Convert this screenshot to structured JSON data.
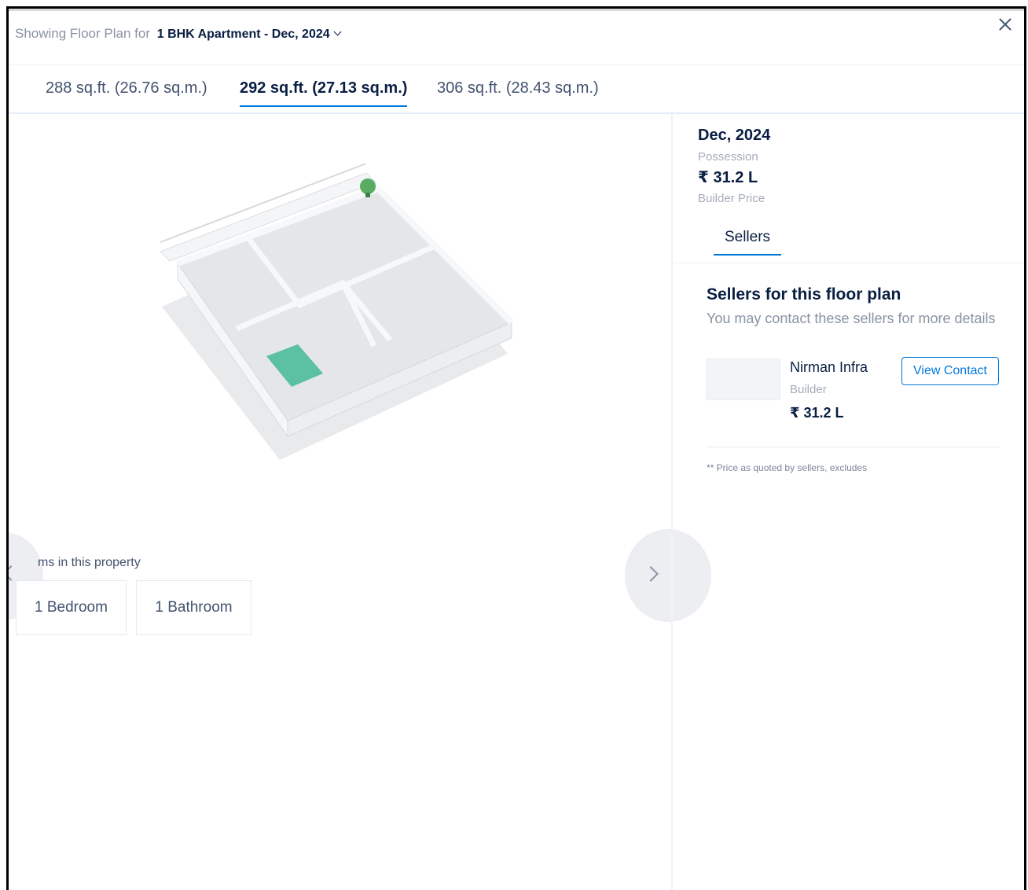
{
  "header": {
    "prefix": "Showing Floor Plan for",
    "selected_config": "1 BHK Apartment - Dec, 2024"
  },
  "size_tabs": [
    {
      "label": "288 sq.ft. (26.76 sq.m.)",
      "active": false
    },
    {
      "label": "292 sq.ft. (27.13 sq.m.)",
      "active": true
    },
    {
      "label": "306 sq.ft. (28.43 sq.m.)",
      "active": false
    }
  ],
  "rooms": {
    "label": "ms in this property",
    "items": [
      "1 Bedroom",
      "1 Bathroom"
    ]
  },
  "details": {
    "possession_date": "Dec, 2024",
    "possession_label": "Possession",
    "price": "₹ 31.2 L",
    "price_label": "Builder Price"
  },
  "sellers_tab": "Sellers",
  "sellers_section": {
    "title": "Sellers for this floor plan",
    "subtitle": "You may contact these sellers for more details",
    "seller": {
      "name": "Nirman Infra",
      "role": "Builder",
      "price": "₹ 31.2 L",
      "contact_label": "View Contact"
    },
    "disclaimer": "** Price as quoted by sellers, excludes"
  },
  "colors": {
    "accent": "#0078db",
    "floor_highlight": "#5cc0a3",
    "marker": "#5aac63"
  },
  "icons": [
    "chevron-down-icon",
    "close-icon",
    "chevron-left-icon",
    "chevron-right-icon",
    "location-pin-icon"
  ]
}
